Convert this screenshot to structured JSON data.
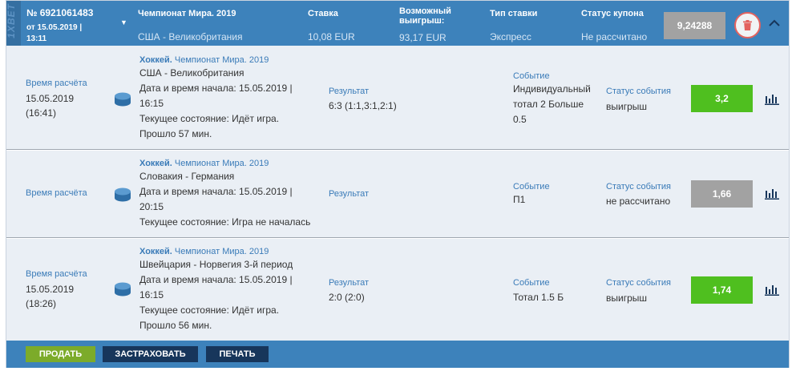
{
  "header": {
    "brand": "1XBET",
    "coupon_number": "№ 6921061483",
    "date_line1": "от 15.05.2019 |",
    "date_line2": "13:11",
    "championship": "Чемпионат Мира. 2019",
    "match": "США - Великобритания",
    "stake_label": "Ставка",
    "stake_value": "10,08 EUR",
    "win_label_1": "Возможный",
    "win_label_2": "выигрыш:",
    "win_value": "93,17 EUR",
    "bet_type_label": "Тип ставки",
    "bet_type_value": "Экспресс",
    "status_label": "Статус купона",
    "status_value": "Не рассчитано",
    "total_coef": "9,24288"
  },
  "rows": [
    {
      "time_label": "Время расчёта",
      "time_date": "15.05.2019",
      "time_clock": "(16:41)",
      "sport": "Хоккей.",
      "league": "Чемпионат Мира. 2019",
      "teams": "США - Великобритания",
      "start_1": "Дата и время начала: 15.05.2019 |",
      "start_2": "16:15",
      "state_1": "Текущее состояние: Идёт игра.",
      "state_2": "Прошло 57 мин.",
      "result_label": "Результат",
      "result_value": "6:3 (1:1,3:1,2:1)",
      "event_label": "Событие",
      "event_1": "Индивидуальный",
      "event_2": "тотал 2 Больше",
      "event_3": "0.5",
      "status_label": "Статус события",
      "status_value": "выигрыш",
      "coef": "3,2",
      "coef_state": "win"
    },
    {
      "time_label": "Время расчёта",
      "sport": "Хоккей.",
      "league": "Чемпионат Мира. 2019",
      "teams": "Словакия - Германия",
      "start_1": "Дата и время начала: 15.05.2019 |",
      "start_2": "20:15",
      "state_1": "Текущее состояние: Игра не началась",
      "result_label": "Результат",
      "event_label": "Событие",
      "event_1": "П1",
      "status_label": "Статус события",
      "status_value": "не рассчитано",
      "coef": "1,66",
      "coef_state": "none"
    },
    {
      "time_label": "Время расчёта",
      "time_date": "15.05.2019",
      "time_clock": "(18:26)",
      "sport": "Хоккей.",
      "league": "Чемпионат Мира. 2019",
      "teams": "Швейцария - Норвегия 3-й период",
      "start_1": "Дата и время начала: 15.05.2019 |",
      "start_2": "16:15",
      "state_1": "Текущее состояние: Идёт игра.",
      "state_2": "Прошло 56 мин.",
      "result_label": "Результат",
      "result_value": "2:0 (2:0)",
      "event_label": "Событие",
      "event_1": "Тотал 1.5 Б",
      "status_label": "Статус события",
      "status_value": "выигрыш",
      "coef": "1,74",
      "coef_state": "win"
    }
  ],
  "footer": {
    "sell_label": "ПРОДАТЬ",
    "insure_label": "ЗАСТРАХОВАТЬ",
    "print_label": "ПЕЧАТЬ"
  },
  "icons": {
    "brand": "brand-logo",
    "expand": "chevron-down-icon",
    "collapse": "chevron-up-icon",
    "delete": "trash-icon",
    "sport": "hockey-puck-icon",
    "stats": "bar-chart-icon"
  },
  "colors": {
    "header_bg": "#3d82bb",
    "row_bg": "#eaeff5",
    "win": "#4fbf1f",
    "pending": "#a2a2a2",
    "sell": "#7cab2a",
    "dark_button": "#17365b",
    "delete_ring": "#e3625f"
  }
}
